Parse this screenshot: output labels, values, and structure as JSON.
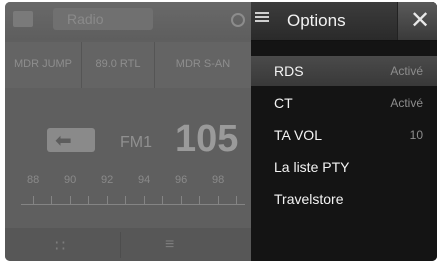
{
  "background": {
    "title": "Radio",
    "presets": [
      "MDR JUMP",
      "89.0 RTL",
      "MDR S-AN"
    ],
    "band": "FM1",
    "frequency": "105",
    "scale_labels": [
      "88",
      "90",
      "92",
      "94",
      "96",
      "98"
    ]
  },
  "options": {
    "title": "Options",
    "close_icon": "close-icon",
    "items": [
      {
        "label": "RDS",
        "value": "Activé",
        "selected": true
      },
      {
        "label": "CT",
        "value": "Activé"
      },
      {
        "label": "TA VOL",
        "value": "10"
      },
      {
        "label": "La liste PTY",
        "value": ""
      },
      {
        "label": "Travelstore",
        "value": ""
      }
    ]
  }
}
